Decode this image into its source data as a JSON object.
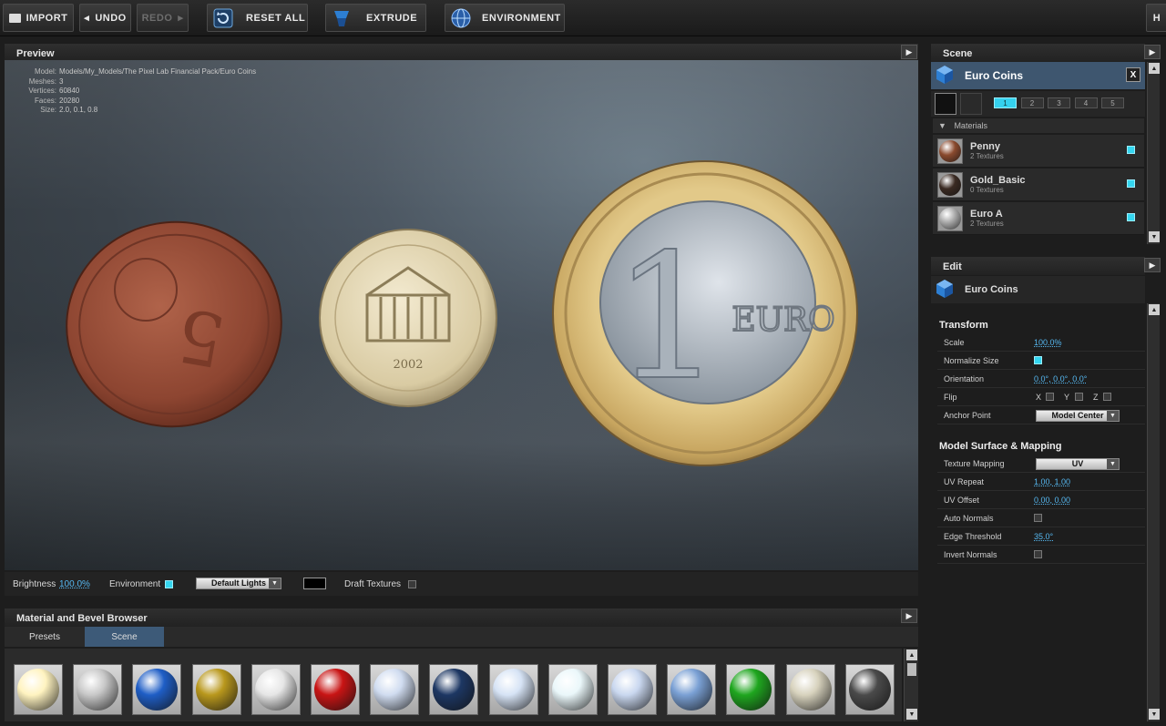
{
  "toolbar": {
    "import": "IMPORT",
    "undo": "UNDO",
    "redo": "REDO",
    "reset_all": "RESET ALL",
    "extrude": "EXTRUDE",
    "environment": "ENVIRONMENT"
  },
  "preview": {
    "title": "Preview",
    "info": {
      "model_label": "Model:",
      "model": "Models/My_Models/The Pixel Lab Financial Pack/Euro Coins",
      "meshes_label": "Meshes:",
      "meshes": "3",
      "vertices_label": "Vertices:",
      "vertices": "60840",
      "faces_label": "Faces:",
      "faces": "20280",
      "size_label": "Size:",
      "size": "2.0, 0.1, 0.8"
    },
    "status": {
      "brightness_label": "Brightness",
      "brightness_value": "100.0%",
      "environment_label": "Environment",
      "environment_checked": true,
      "lights_option": "Default Lights",
      "draft_label": "Draft Textures",
      "draft_checked": false
    }
  },
  "browser": {
    "title": "Material and Bevel Browser",
    "tabs": [
      "Presets",
      "Scene"
    ],
    "active_tab": "Scene",
    "swatches": [
      {
        "name": "glow",
        "color": "#fff3c0"
      },
      {
        "name": "silver-matte",
        "color": "#c8c8c8"
      },
      {
        "name": "blue",
        "color": "#1f5ec6"
      },
      {
        "name": "gold",
        "color": "#b9981d"
      },
      {
        "name": "striped-white",
        "color": "#e6e6e6"
      },
      {
        "name": "red",
        "color": "#c81414"
      },
      {
        "name": "american-blue",
        "color": "#d0dcf0"
      },
      {
        "name": "navy",
        "color": "#1d3763"
      },
      {
        "name": "american-blue-2",
        "color": "#d6e3f5"
      },
      {
        "name": "white-gloss",
        "color": "#eaf7fa"
      },
      {
        "name": "american-blue-3",
        "color": "#c9d7ef"
      },
      {
        "name": "chrome-blue",
        "color": "#7aa0d4"
      },
      {
        "name": "green",
        "color": "#1fa61f"
      },
      {
        "name": "cream",
        "color": "#d7d2bd"
      },
      {
        "name": "dark-gray",
        "color": "#4a4a4a"
      }
    ]
  },
  "scene": {
    "title": "Scene",
    "object_name": "Euro Coins",
    "close": "X",
    "layers": [
      "1",
      "2",
      "3",
      "4",
      "5"
    ],
    "active_layer": "1",
    "materials_header": "Materials",
    "materials": [
      {
        "name": "Penny",
        "sub": "2 Textures",
        "color": "#8a4a2e",
        "checked": true
      },
      {
        "name": "Gold_Basic",
        "sub": "0 Textures",
        "color": "#3a2a22",
        "checked": true
      },
      {
        "name": "Euro A",
        "sub": "2 Textures",
        "color": "#a9a9a9",
        "checked": true
      }
    ]
  },
  "edit": {
    "title": "Edit",
    "object_name": "Euro Coins",
    "transform_title": "Transform",
    "scale_label": "Scale",
    "scale": "100.0%",
    "normalize_label": "Normalize Size",
    "normalize_checked": true,
    "orientation_label": "Orientation",
    "orientation": "0.0°, 0.0°, 0.0°",
    "flip_label": "Flip",
    "flip_x": "X",
    "flip_y": "Y",
    "flip_z": "Z",
    "anchor_label": "Anchor Point",
    "anchor": "Model Center",
    "surface_title": "Model Surface & Mapping",
    "mapping_label": "Texture Mapping",
    "mapping": "UV",
    "uv_repeat_label": "UV Repeat",
    "uv_repeat": "1.00, 1.00",
    "uv_offset_label": "UV Offset",
    "uv_offset": "0.00, 0.00",
    "auto_normals_label": "Auto Normals",
    "edge_label": "Edge Threshold",
    "edge": "35.0°",
    "invert_label": "Invert Normals"
  },
  "coins": {
    "euro_text": "EURO",
    "year": "2002",
    "one": "1"
  }
}
